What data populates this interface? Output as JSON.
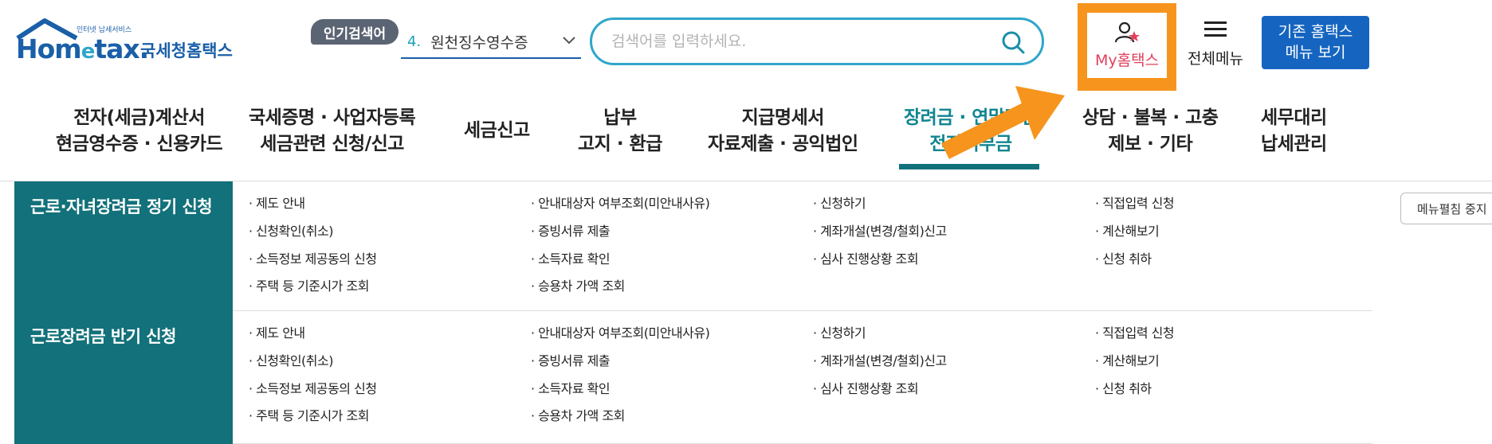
{
  "logo": {
    "sub": "인터넷 납세서비스",
    "brand_home": "Hom",
    "brand_e": "e",
    "brand_tax": "tax.",
    "brand_kr": "국세청홈택스"
  },
  "popular": {
    "badge": "인기검색어",
    "rank": "4.",
    "term": "원천징수영수증"
  },
  "search": {
    "placeholder": "검색어를 입력하세요."
  },
  "my_hometax": {
    "label": "My홈택스"
  },
  "all_menu": {
    "label": "전체메뉴"
  },
  "old_hometax": {
    "line1": "기존 홈택스",
    "line2": "메뉴 보기"
  },
  "nav": [
    {
      "line1": "전자(세금)계산서",
      "line2": "현금영수증 · 신용카드"
    },
    {
      "line1": "국세증명 · 사업자등록",
      "line2": "세금관련 신청/신고"
    },
    {
      "line1": "세금신고",
      "line2": ""
    },
    {
      "line1": "납부",
      "line2": "고지 · 환급"
    },
    {
      "line1": "지급명세서",
      "line2": "자료제출 · 공익법인"
    },
    {
      "line1": "장려금 · 연말정산",
      "line2": "전자기부금"
    },
    {
      "line1": "상담 · 불복 · 고충",
      "line2": "제보 · 기타"
    },
    {
      "line1": "세무대리",
      "line2": "납세관리"
    }
  ],
  "sections": [
    {
      "title": "근로·자녀장려금 정기 신청",
      "links": [
        [
          "제도 안내",
          "안내대상자 여부조회(미안내사유)",
          "신청하기",
          "직접입력 신청"
        ],
        [
          "신청확인(취소)",
          "증빙서류 제출",
          "계좌개설(변경/철회)신고",
          "계산해보기"
        ],
        [
          "소득정보 제공동의 신청",
          "소득자료 확인",
          "심사 진행상황 조회",
          "신청 취하"
        ],
        [
          "주택 등 기준시가 조회",
          "승용차 가액 조회",
          "",
          ""
        ]
      ]
    },
    {
      "title": "근로장려금 반기 신청",
      "links": [
        [
          "제도 안내",
          "안내대상자 여부조회(미안내사유)",
          "신청하기",
          "직접입력 신청"
        ],
        [
          "신청확인(취소)",
          "증빙서류 제출",
          "계좌개설(변경/철회)신고",
          "계산해보기"
        ],
        [
          "소득정보 제공동의 신청",
          "소득자료 확인",
          "심사 진행상황 조회",
          "신청 취하"
        ],
        [
          "주택 등 기준시가 조회",
          "승용차 가액 조회",
          "",
          ""
        ]
      ]
    }
  ],
  "side_button": {
    "label": "메뉴펼침 중지"
  },
  "colors": {
    "brand_blue": "#1a5fa8",
    "teal": "#12717a",
    "active_nav": "#118591",
    "highlight_orange": "#f7941d",
    "old_hometax_bg": "#1565c0"
  },
  "icons": [
    "house-roof-icon",
    "chevron-down-icon",
    "search-icon",
    "user-star-icon",
    "hamburger-icon",
    "arrow-pointer-icon"
  ]
}
